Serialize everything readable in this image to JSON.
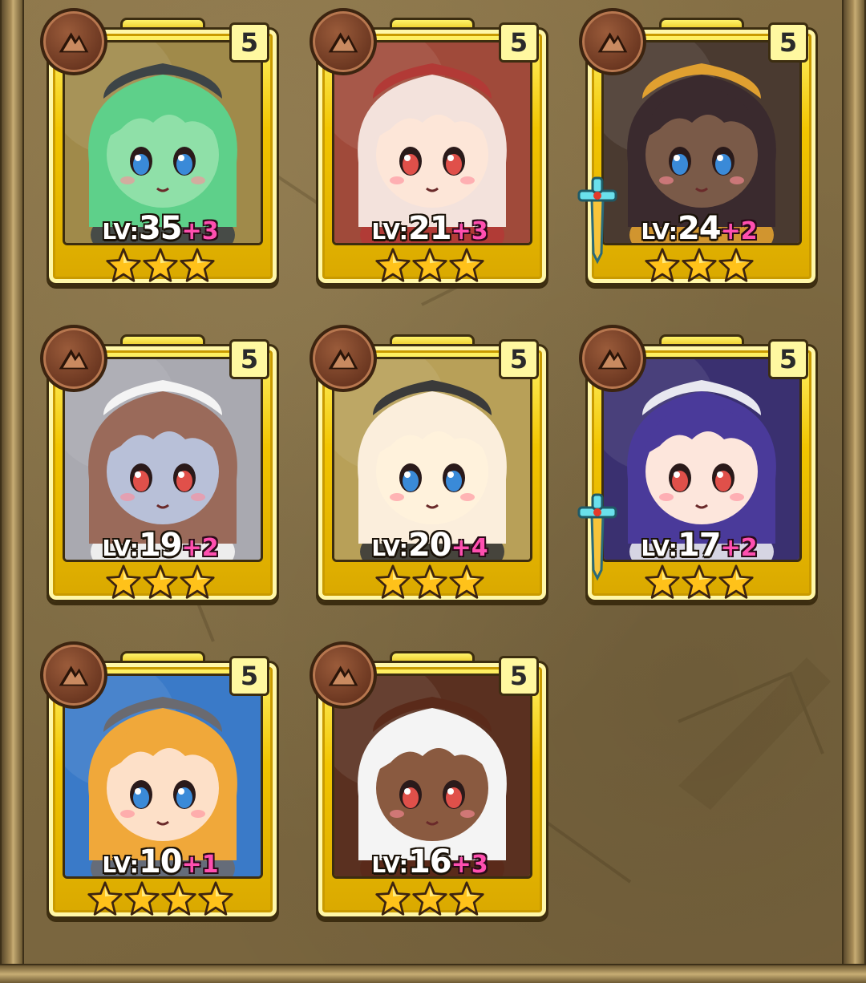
{
  "panel": {
    "colors": {
      "gold": "#f2c500",
      "level_plus": "#ff4fb0",
      "badge": "#7a4128"
    }
  },
  "heroes": [
    {
      "level_prefix": "LV:",
      "level": "35",
      "bonus": "+3",
      "grade": "5",
      "stars": 3,
      "class_icon": "class-mountain-icon",
      "has_weapon": false,
      "portrait_colors": {
        "hair": "#5ed08a",
        "skin": "#8fe0a8",
        "hat": "#3d4447",
        "bg": "#a08a4a"
      },
      "portrait_icon": "green-hair-helmet-girl-portrait"
    },
    {
      "level_prefix": "LV:",
      "level": "21",
      "bonus": "+3",
      "grade": "5",
      "stars": 3,
      "class_icon": "class-mountain-icon",
      "has_weapon": false,
      "portrait_colors": {
        "hair": "#f3e2dc",
        "skin": "#fde6d8",
        "hat": "#b23a36",
        "bg": "#a04a3a"
      },
      "portrait_icon": "red-hood-bunny-girl-portrait"
    },
    {
      "level_prefix": "LV:",
      "level": "24",
      "bonus": "+2",
      "grade": "5",
      "stars": 3,
      "class_icon": "class-mountain-icon",
      "has_weapon": true,
      "portrait_colors": {
        "hair": "#3a2a2e",
        "skin": "#7a5a48",
        "hat": "#e0a030",
        "bg": "#4a3a30"
      },
      "portrait_icon": "braided-dark-hair-girl-portrait"
    },
    {
      "level_prefix": "LV:",
      "level": "19",
      "bonus": "+2",
      "grade": "5",
      "stars": 3,
      "class_icon": "class-mountain-icon",
      "has_weapon": false,
      "portrait_colors": {
        "hair": "#9a6a5a",
        "skin": "#b8c0d8",
        "hat": "#f4f4f4",
        "bg": "#a9a9b0"
      },
      "portrait_icon": "chef-hat-zombie-girl-portrait"
    },
    {
      "level_prefix": "LV:",
      "level": "20",
      "bonus": "+4",
      "grade": "5",
      "stars": 3,
      "class_icon": "class-mountain-icon",
      "has_weapon": false,
      "portrait_colors": {
        "hair": "#fbeedc",
        "skin": "#fff2dc",
        "hat": "#3a3a3a",
        "bg": "#b8a058"
      },
      "portrait_icon": "goggles-fairy-girl-portrait"
    },
    {
      "level_prefix": "LV:",
      "level": "17",
      "bonus": "+2",
      "grade": "5",
      "stars": 3,
      "class_icon": "class-mountain-icon",
      "has_weapon": true,
      "portrait_colors": {
        "hair": "#4a3a9a",
        "skin": "#fde6dc",
        "hat": "#e8e8f0",
        "bg": "#3a3070"
      },
      "portrait_icon": "long-purple-hair-girl-portrait"
    },
    {
      "level_prefix": "LV:",
      "level": "10",
      "bonus": "+1",
      "grade": "5",
      "stars": 4,
      "class_icon": "class-mountain-icon",
      "has_weapon": false,
      "portrait_colors": {
        "hair": "#f0a83a",
        "skin": "#fde0c8",
        "hat": "#6a6a70",
        "bg": "#3a7ac8"
      },
      "portrait_icon": "wolf-ear-warrior-girl-portrait"
    },
    {
      "level_prefix": "LV:",
      "level": "16",
      "bonus": "+3",
      "grade": "5",
      "stars": 3,
      "class_icon": "class-mountain-icon",
      "has_weapon": false,
      "portrait_colors": {
        "hair": "#f4f4f4",
        "skin": "#8a5a40",
        "hat": "#5a2a1a",
        "bg": "#5a3020"
      },
      "portrait_icon": "white-braid-chocolate-girl-portrait"
    }
  ]
}
